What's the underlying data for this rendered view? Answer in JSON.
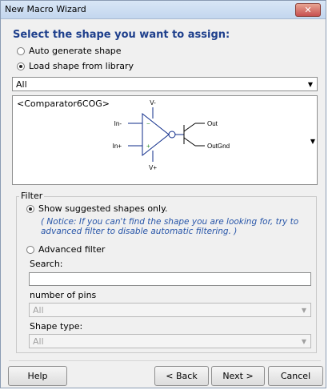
{
  "window": {
    "title": "New Macro Wizard",
    "close_glyph": "✕"
  },
  "heading": "Select the shape you want to assign:",
  "options": {
    "auto_generate": "Auto generate shape",
    "load_library": "Load shape from library"
  },
  "library_filter": {
    "value": "All"
  },
  "preview": {
    "shape_name": "<Comparator6COG>",
    "pins": {
      "v_minus": "V-",
      "v_plus": "V+",
      "in_minus": "In-",
      "in_plus": "In+",
      "out": "Out",
      "out_gnd": "OutGnd",
      "minus_sign": "−",
      "plus_sign": "+"
    }
  },
  "filter": {
    "legend": "Filter",
    "show_suggested": "Show suggested shapes only.",
    "notice": "( Notice: If you can't find the shape you are looking for, try to advanced filter to disable automatic filtering. )",
    "advanced": "Advanced filter",
    "search_label": "Search:",
    "search_value": "",
    "pins_label": "number of pins",
    "pins_value": "All",
    "type_label": "Shape type:",
    "type_value": "All"
  },
  "buttons": {
    "help": "Help",
    "back": "< Back",
    "next": "Next >",
    "cancel": "Cancel"
  }
}
